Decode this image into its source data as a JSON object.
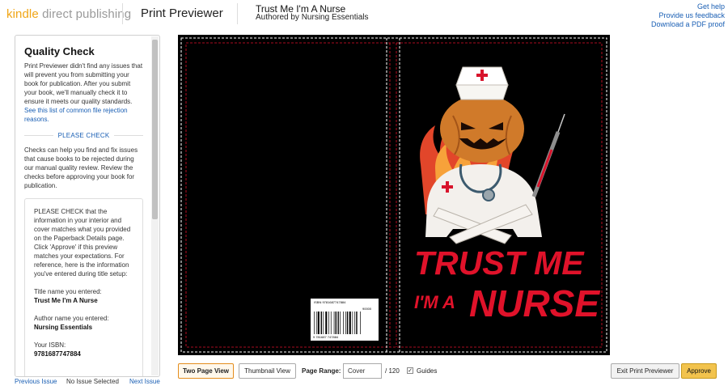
{
  "header": {
    "logo_kindle": "kindle",
    "logo_rest": " direct publishing",
    "app_title": "Print Previewer",
    "book_title": "Trust Me I'm A Nurse",
    "book_author": "Authored by Nursing Essentials",
    "links": [
      "Get help",
      "Provide us feedback",
      "Download a PDF proof"
    ]
  },
  "sidebar": {
    "title": "Quality Check",
    "intro": "Print Previewer didn't find any issues that will prevent you from submitting your book for publication. After you submit your book, we'll manually check it to ensure it meets our quality standards. ",
    "intro_link": "See this list of common file rejection reasons.",
    "please_check": "PLEASE CHECK",
    "checks_text": "Checks can help you find and fix issues that cause books to be rejected during our manual quality review. Review the checks before approving your book for publication.",
    "box": {
      "text": "PLEASE CHECK that the information in your interior and cover matches what you provided on the Paperback Details page. Click 'Approve' if this preview matches your expectations. For reference, here is the information you've entered during title setup:",
      "title_label": "Title name you entered:",
      "title_value": "Trust Me I'm A Nurse",
      "author_label": "Author name you entered:",
      "author_value": "Nursing Essentials",
      "isbn_label": "Your ISBN:",
      "isbn_value": "9781687747884"
    }
  },
  "bottom_nav": {
    "previous": "Previous Issue",
    "status": "No Issue Selected",
    "next": "Next Issue"
  },
  "cover": {
    "headline_line1": "TRUST ME",
    "headline_small": "I'M A",
    "headline_big": "NURSE",
    "barcode_isbn_top": "ISBN 9781687747884",
    "barcode_price": "90000",
    "barcode_digits": "9 781687 747884",
    "colors": {
      "background": "#000000",
      "text_red": "#e0122a",
      "guide_red": "#e0122a",
      "trim_white": "#ffffff"
    }
  },
  "toolbar": {
    "two_page_view": "Two Page View",
    "thumbnail_view": "Thumbnail View",
    "page_range_label": "Page Range:",
    "page_range_value": "Cover",
    "page_total": "/ 120",
    "guides_label": "Guides",
    "guides_checked": true,
    "exit_label": "Exit Print Previewer",
    "approve_label": "Approve"
  }
}
